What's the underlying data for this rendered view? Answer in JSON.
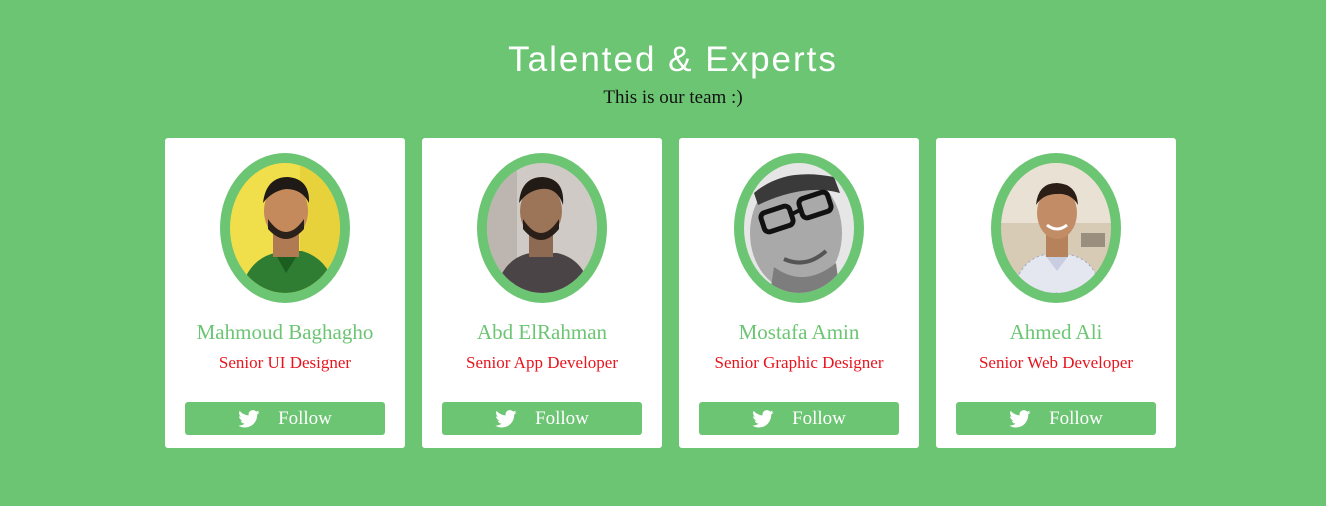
{
  "header": {
    "title": "Talented & Experts",
    "subtitle": "This is our team :)"
  },
  "colors": {
    "background": "#6cc573",
    "accent": "#6cc573",
    "role_text": "#e8141e",
    "card": "#ffffff"
  },
  "team": [
    {
      "name": "Mahmoud Baghagho",
      "role": "Senior UI Designer",
      "follow_label": "Follow",
      "follow_icon": "twitter-icon"
    },
    {
      "name": "Abd ElRahman",
      "role": "Senior App Developer",
      "follow_label": "Follow",
      "follow_icon": "twitter-icon"
    },
    {
      "name": "Mostafa Amin",
      "role": "Senior Graphic Designer",
      "follow_label": "Follow",
      "follow_icon": "twitter-icon"
    },
    {
      "name": "Ahmed Ali",
      "role": "Senior Web Developer",
      "follow_label": "Follow",
      "follow_icon": "twitter-icon"
    }
  ]
}
